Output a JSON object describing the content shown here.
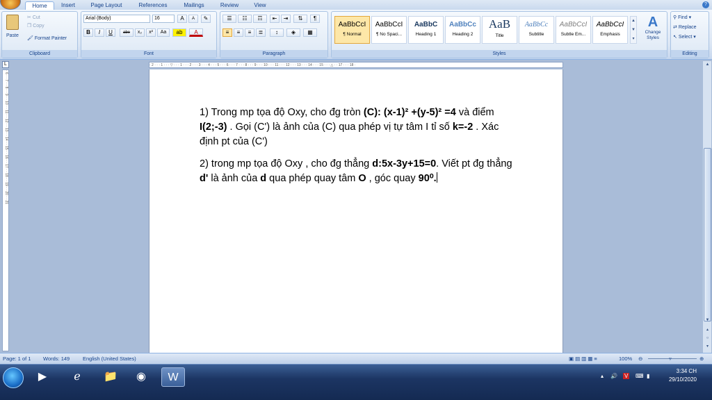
{
  "tabs": [
    "Home",
    "Insert",
    "Page Layout",
    "References",
    "Mailings",
    "Review",
    "View"
  ],
  "clipboard": {
    "paste": "Paste",
    "cut": "Cut",
    "copy": "Copy",
    "format_painter": "Format Painter",
    "label": "Clipboard"
  },
  "font": {
    "name": "Arial (Body)",
    "size": "16",
    "label": "Font",
    "bold": "B",
    "italic": "I",
    "underline": "U",
    "strike": "abe",
    "sub": "x₂",
    "sup": "x²",
    "case": "Aa"
  },
  "paragraph": {
    "label": "Paragraph"
  },
  "styles": {
    "label": "Styles",
    "items": [
      {
        "sample": "AaBbCcI",
        "name": "¶ Normal"
      },
      {
        "sample": "AaBbCcI",
        "name": "¶ No Spaci..."
      },
      {
        "sample": "AaBbC",
        "name": "Heading 1"
      },
      {
        "sample": "AaBbCc",
        "name": "Heading 2"
      },
      {
        "sample": "AaB",
        "name": "Title"
      },
      {
        "sample": "AaBbCc",
        "name": "Subtitle"
      },
      {
        "sample": "AaBbCcI",
        "name": "Subtle Em..."
      },
      {
        "sample": "AaBbCcI",
        "name": "Emphasis"
      }
    ],
    "change_styles": "Change Styles"
  },
  "editing": {
    "label": "Editing",
    "find": "Find",
    "replace": "Replace",
    "select": "Select"
  },
  "document": {
    "p1": {
      "t1": "1) Trong mp tọa độ Oxy, cho đg tròn ",
      "b1": "(C): (x-1)² +(y-5)² =4",
      "t2": " và điểm ",
      "b2": "I(2;-3)",
      "t3": " . Gọi (C') là ảnh của (C) qua phép vị tự tâm I tỉ số ",
      "b3": "k=-2",
      "t4": " . Xác định pt của (C')"
    },
    "p2": {
      "t1": "2) trong mp tọa độ Oxy , cho đg thẳng ",
      "b1": "d:5x-3y+15=0",
      "t2": ". Viết pt đg thẳng ",
      "b2": "d'",
      "t3": " là ảnh của ",
      "b3": "d",
      "t4": " qua phép quay tâm ",
      "b4": "O",
      "t5": " , góc quay ",
      "b5": "90⁰."
    }
  },
  "status": {
    "page": "Page: 1 of 1",
    "words": "Words: 149",
    "language": "English (United States)",
    "zoom": "100%"
  },
  "taskbar": {
    "time": "3:34 CH",
    "date": "29/10/2020"
  }
}
